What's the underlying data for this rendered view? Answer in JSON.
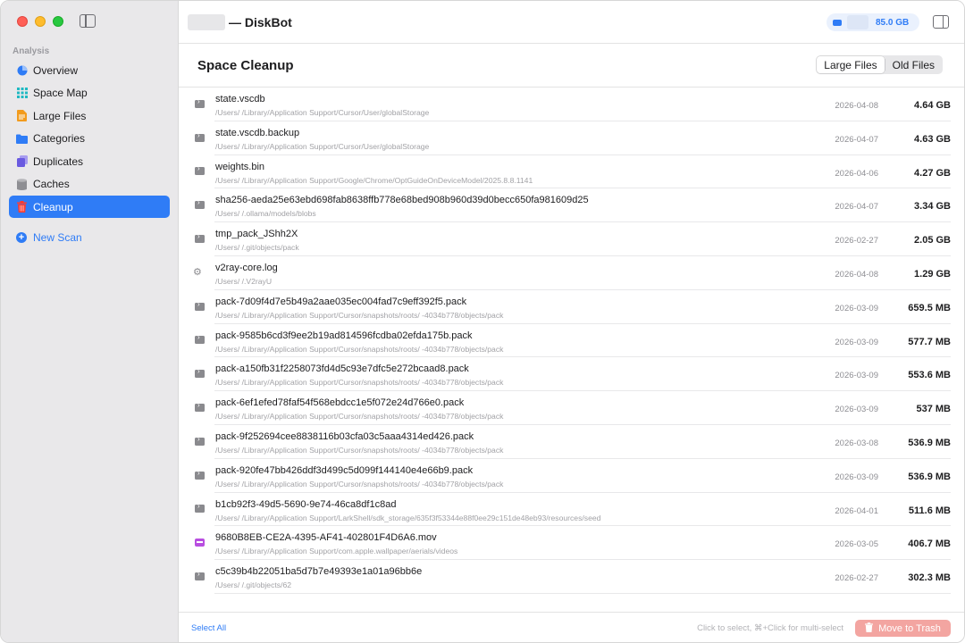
{
  "sidebar": {
    "section": "Analysis",
    "items": [
      {
        "label": "Overview",
        "icon": "pie-chart-icon",
        "color": "#2f7cf6",
        "active": false
      },
      {
        "label": "Space Map",
        "icon": "grid-icon",
        "color": "#1fb9c2",
        "active": false
      },
      {
        "label": "Large Files",
        "icon": "document-icon",
        "color": "#f29b1d",
        "active": false
      },
      {
        "label": "Categories",
        "icon": "folder-icon",
        "color": "#2f7cf6",
        "active": false
      },
      {
        "label": "Duplicates",
        "icon": "duplicate-icon",
        "color": "#6a5ae0",
        "active": false
      },
      {
        "label": "Caches",
        "icon": "cylinder-icon",
        "color": "#8e8e93",
        "active": false
      },
      {
        "label": "Cleanup",
        "icon": "trash-icon",
        "color": "#ff3b30",
        "active": true
      }
    ],
    "new_scan": "New Scan"
  },
  "titlebar": {
    "title": "— DiskBot",
    "disk_free": "85.0 GB"
  },
  "header": {
    "title": "Space Cleanup",
    "tabs": [
      {
        "label": "Large Files",
        "active": true
      },
      {
        "label": "Old Files",
        "active": false
      }
    ]
  },
  "files": [
    {
      "name": "state.vscdb",
      "path": "/Users/        /Library/Application Support/Cursor/User/globalStorage",
      "date": "2026-04-08",
      "size": "4.64 GB",
      "icon": "folder"
    },
    {
      "name": "state.vscdb.backup",
      "path": "/Users/        /Library/Application Support/Cursor/User/globalStorage",
      "date": "2026-04-07",
      "size": "4.63 GB",
      "icon": "folder"
    },
    {
      "name": "weights.bin",
      "path": "/Users/        /Library/Application Support/Google/Chrome/OptGuideOnDeviceModel/2025.8.8.1141",
      "date": "2026-04-06",
      "size": "4.27 GB",
      "icon": "folder"
    },
    {
      "name": "sha256-aeda25e63ebd698fab8638ffb778e68bed908b960d39d0becc650fa981609d25",
      "path": "/Users/        /.ollama/models/blobs",
      "date": "2026-04-07",
      "size": "3.34 GB",
      "icon": "folder"
    },
    {
      "name": "tmp_pack_JShh2X",
      "path": "/Users/        /.git/objects/pack",
      "date": "2026-02-27",
      "size": "2.05 GB",
      "icon": "folder"
    },
    {
      "name": "v2ray-core.log",
      "path": "/Users/        /.V2rayU",
      "date": "2026-04-08",
      "size": "1.29 GB",
      "icon": "gear"
    },
    {
      "name": "pack-7d09f4d7e5b49a2aae035ec004fad7c9eff392f5.pack",
      "path": "/Users/        /Library/Application Support/Cursor/snapshots/roots/        -4034b778/objects/pack",
      "date": "2026-03-09",
      "size": "659.5 MB",
      "icon": "folder"
    },
    {
      "name": "pack-9585b6cd3f9ee2b19ad814596fcdba02efda175b.pack",
      "path": "/Users/        /Library/Application Support/Cursor/snapshots/roots/        -4034b778/objects/pack",
      "date": "2026-03-09",
      "size": "577.7 MB",
      "icon": "folder"
    },
    {
      "name": "pack-a150fb31f2258073fd4d5c93e7dfc5e272bcaad8.pack",
      "path": "/Users/        /Library/Application Support/Cursor/snapshots/roots/        -4034b778/objects/pack",
      "date": "2026-03-09",
      "size": "553.6 MB",
      "icon": "folder"
    },
    {
      "name": "pack-6ef1efed78faf54f568ebdcc1e5f072e24d766e0.pack",
      "path": "/Users/        /Library/Application Support/Cursor/snapshots/roots/        -4034b778/objects/pack",
      "date": "2026-03-09",
      "size": "537 MB",
      "icon": "folder"
    },
    {
      "name": "pack-9f252694cee8838116b03cfa03c5aaa4314ed426.pack",
      "path": "/Users/        /Library/Application Support/Cursor/snapshots/roots/        -4034b778/objects/pack",
      "date": "2026-03-08",
      "size": "536.9 MB",
      "icon": "folder"
    },
    {
      "name": "pack-920fe47bb426ddf3d499c5d099f144140e4e66b9.pack",
      "path": "/Users/        /Library/Application Support/Cursor/snapshots/roots/        -4034b778/objects/pack",
      "date": "2026-03-09",
      "size": "536.9 MB",
      "icon": "folder"
    },
    {
      "name": "b1cb92f3-49d5-5690-9e74-46ca8df1c8ad",
      "path": "/Users/        /Library/Application Support/LarkShell/sdk_storage/635f3f53344e88f0ee29c151de48eb93/resources/seed",
      "date": "2026-04-01",
      "size": "511.6 MB",
      "icon": "folder"
    },
    {
      "name": "9680B8EB-CE2A-4395-AF41-402801F4D6A6.mov",
      "path": "/Users/        /Library/Application Support/com.apple.wallpaper/aerials/videos",
      "date": "2026-03-05",
      "size": "406.7 MB",
      "icon": "video"
    },
    {
      "name": "c5c39b4b22051ba5d7b7e49393e1a01a96bb6e",
      "path": "/Users/        /.git/objects/62",
      "date": "2026-02-27",
      "size": "302.3 MB",
      "icon": "folder"
    }
  ],
  "footer": {
    "select_all": "Select All",
    "hint": "Click to select, ⌘+Click for multi-select",
    "trash_button": "Move to Trash"
  }
}
